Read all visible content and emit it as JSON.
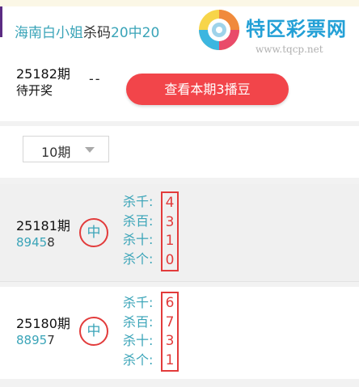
{
  "header": {
    "title_blue": "海南白小姐",
    "title_dark": "杀码",
    "title_blue2": "20中20",
    "logo_text": "特区彩票网",
    "logo_url": "www.tqcp.net"
  },
  "current": {
    "period": "25182期",
    "status": "待开奖",
    "dash": "--",
    "button_label": "查看本期3播豆"
  },
  "filter": {
    "selected": "10期"
  },
  "rows": [
    {
      "period": "25181期",
      "numbers_prefix": "8945",
      "numbers_last": "8",
      "badge": "中",
      "labels": [
        "杀千:",
        "杀百:",
        "杀十:",
        "杀个:"
      ],
      "digits": [
        "4",
        "3",
        "1",
        "0"
      ]
    },
    {
      "period": "25180期",
      "numbers_prefix": "8895",
      "numbers_last": "7",
      "badge": "中",
      "labels": [
        "杀千:",
        "杀百:",
        "杀十:",
        "杀个:"
      ],
      "digits": [
        "6",
        "7",
        "3",
        "1"
      ]
    }
  ],
  "colors": {
    "accent_blue": "#3aa4b8",
    "accent_red": "#e23b3b",
    "button_red": "#f2454a"
  }
}
